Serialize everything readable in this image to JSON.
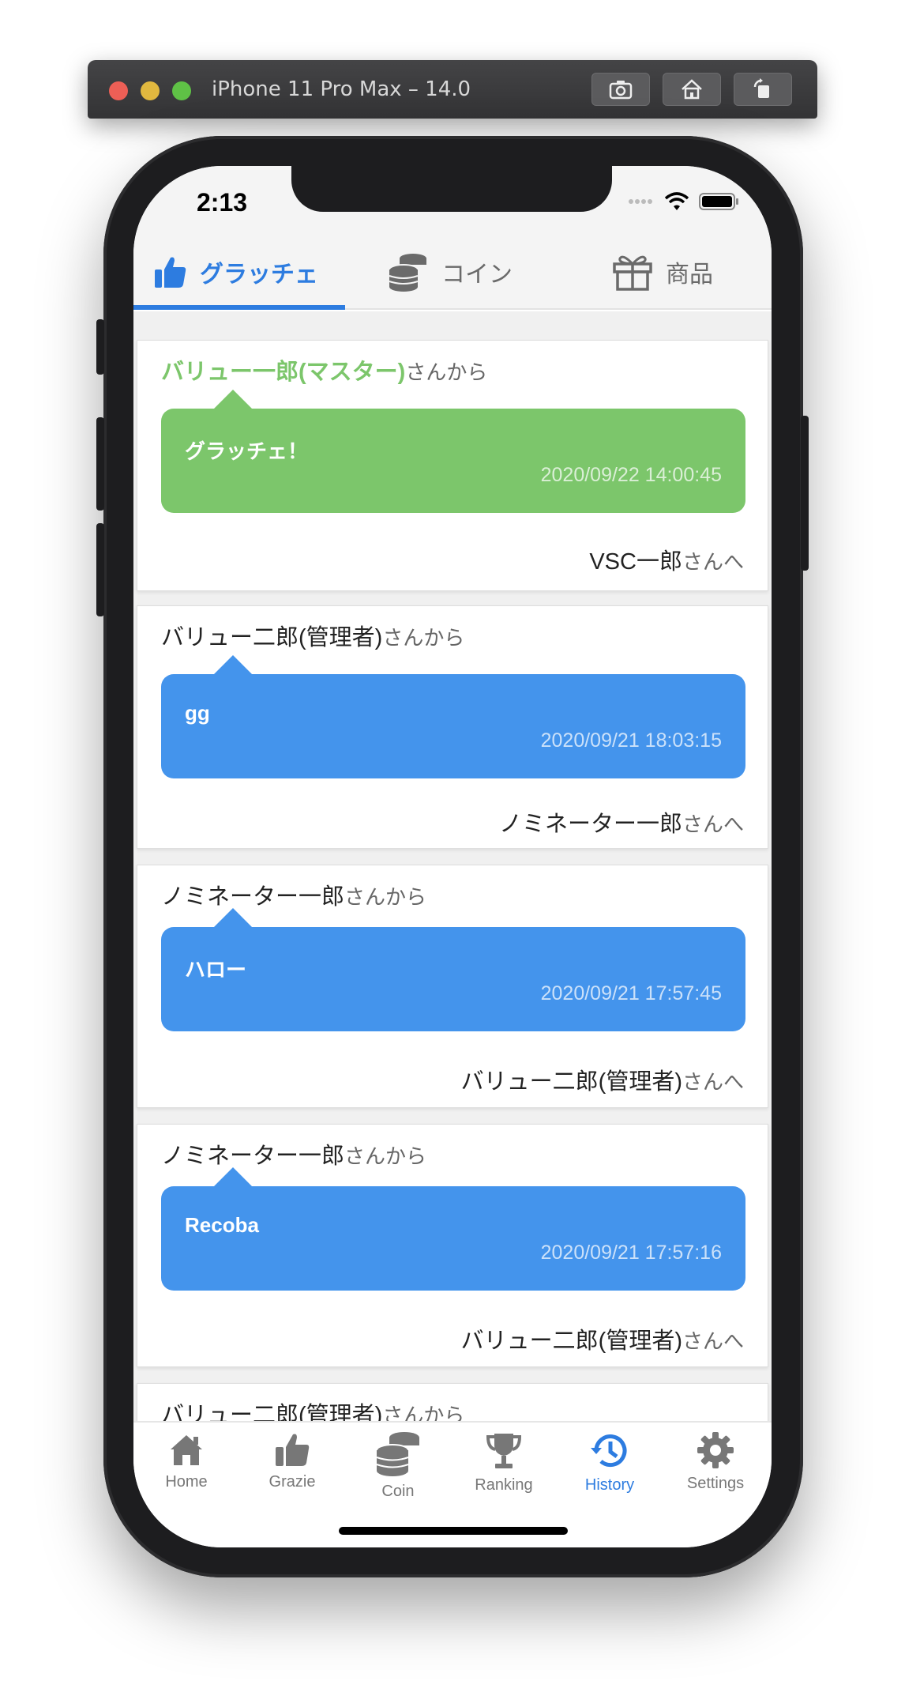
{
  "simulator": {
    "title": "iPhone 11 Pro Max – 14.0",
    "icons": [
      "screenshot-icon",
      "home-icon",
      "rotate-icon"
    ]
  },
  "status_bar": {
    "time": "2:13"
  },
  "top_tabs": [
    {
      "label": "グラッチェ",
      "icon": "thumbs-up-icon",
      "active": true
    },
    {
      "label": "コイン",
      "icon": "coins-icon",
      "active": false
    },
    {
      "label": "商品",
      "icon": "gift-icon",
      "active": false
    }
  ],
  "history": [
    {
      "from_name": "バリュー一郎(マスター)",
      "from_suffix": "さんから",
      "message": "グラッチェ！",
      "date": "2020/09/22 14:00:45",
      "to_name": "VSC一郎",
      "to_suffix": "さんへ",
      "color": "#7cc66b"
    },
    {
      "from_name": "バリュー二郎(管理者)",
      "from_suffix": "さんから",
      "message": "gg",
      "date": "2020/09/21 18:03:15",
      "to_name": "ノミネーター一郎",
      "to_suffix": "さんへ",
      "color": "#4494ec"
    },
    {
      "from_name": "ノミネーター一郎",
      "from_suffix": "さんから",
      "message": "ハロー",
      "date": "2020/09/21 17:57:45",
      "to_name": "バリュー二郎(管理者)",
      "to_suffix": "さんへ",
      "color": "#4494ec"
    },
    {
      "from_name": "ノミネーター一郎",
      "from_suffix": "さんから",
      "message": "Recoba",
      "date": "2020/09/21 17:57:16",
      "to_name": "バリュー二郎(管理者)",
      "to_suffix": "さんへ",
      "color": "#4494ec"
    },
    {
      "from_name": "バリュー二郎(管理者)",
      "from_suffix": "さんから"
    }
  ],
  "bottom_nav": [
    {
      "label": "Home",
      "icon": "home-icon",
      "active": false
    },
    {
      "label": "Grazie",
      "icon": "thumbs-up-icon",
      "active": false
    },
    {
      "label": "Coin",
      "icon": "coins-icon",
      "active": false
    },
    {
      "label": "Ranking",
      "icon": "trophy-icon",
      "active": false
    },
    {
      "label": "History",
      "icon": "history-icon",
      "active": true
    },
    {
      "label": "Settings",
      "icon": "gear-icon",
      "active": false
    }
  ],
  "colors": {
    "accent": "#2d7ce0",
    "grazie_green": "#7cc66b",
    "bubble_blue": "#4494ec"
  }
}
